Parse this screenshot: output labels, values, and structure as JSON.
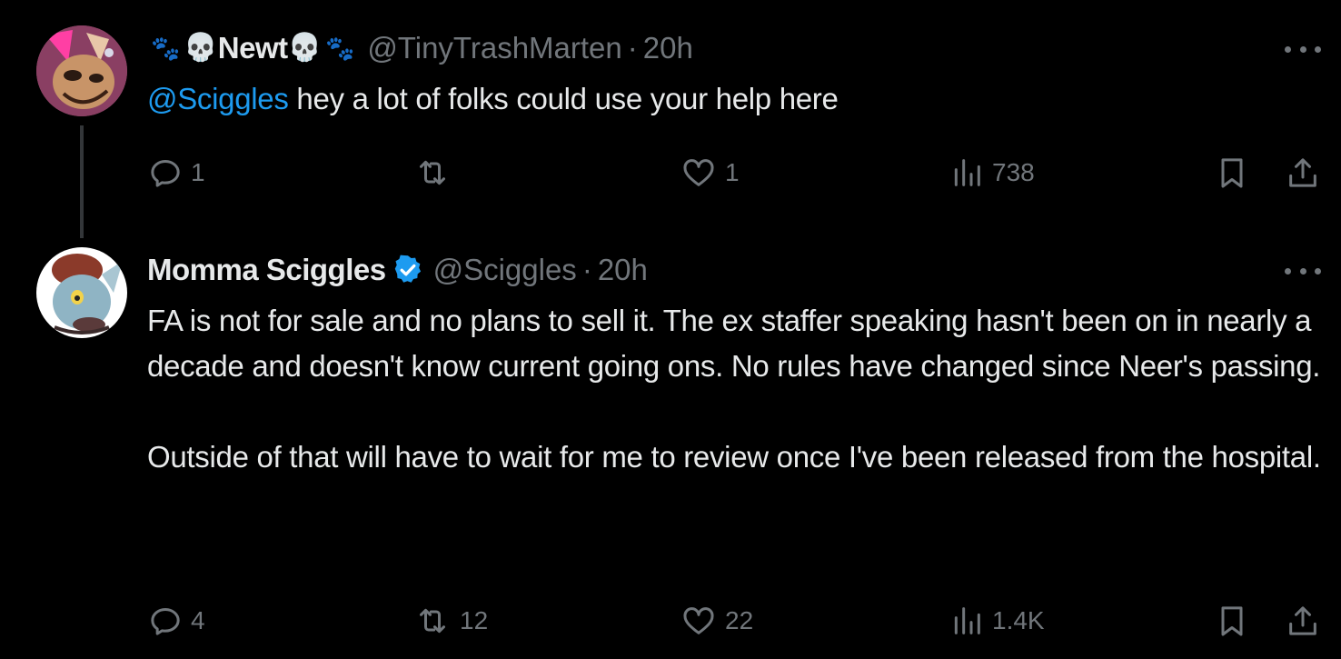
{
  "tweets": [
    {
      "display_name": "Newt",
      "handle": "@TinyTrashMarten",
      "separator": "·",
      "time": "20h",
      "mention": "@Sciggles",
      "text": " hey a lot of folks could use your help here",
      "stats": {
        "replies": "1",
        "retweets": "",
        "likes": "1",
        "views": "738"
      },
      "avatar_colors": {
        "bg": "#7a2a4e",
        "accent": "#ff3fa4",
        "fur": "#c89468"
      }
    },
    {
      "display_name": "Momma Sciggles",
      "verified": true,
      "handle": "@Sciggles",
      "separator": "·",
      "time": "20h",
      "paragraphs": [
        "FA is not for sale and no plans to sell it. The ex staffer speaking hasn't been on in nearly a decade and doesn't know current going ons. No rules have changed since Neer's passing.",
        "Outside of that will have to wait for me to review once I've been released from the hospital."
      ],
      "stats": {
        "replies": "4",
        "retweets": "12",
        "likes": "22",
        "views": "1.4K"
      },
      "avatar_colors": {
        "bg": "#ffffff",
        "accent": "#8b3a2a",
        "fur": "#8fb4c4"
      }
    }
  ],
  "colors": {
    "background": "#000000",
    "text": "#e7e9ea",
    "muted": "#71767b",
    "mention": "#1d9bf0",
    "verified": "#1d9bf0",
    "thread_line": "#333639"
  },
  "icons": {
    "reply": "reply-icon",
    "retweet": "retweet-icon",
    "like": "heart-icon",
    "views": "views-icon",
    "bookmark": "bookmark-icon",
    "share": "share-icon",
    "more": "more-icon",
    "verified": "verified-badge-icon",
    "skull": "skull-emoji-icon",
    "paw": "paw-emoji-icon"
  }
}
